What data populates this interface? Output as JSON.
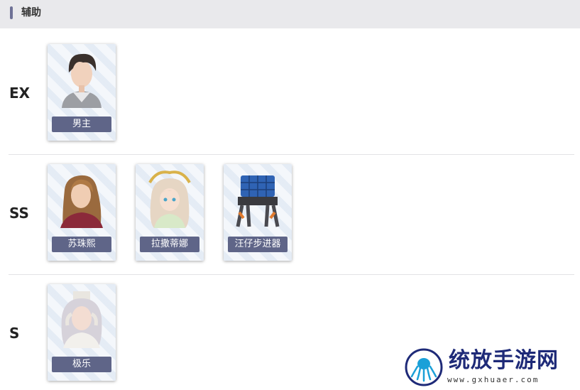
{
  "header": {
    "title": "辅助"
  },
  "tiers": [
    {
      "label": "EX",
      "characters": [
        {
          "name": "男主",
          "icon": "male-lead-portrait"
        }
      ]
    },
    {
      "label": "SS",
      "characters": [
        {
          "name": "苏珠熙",
          "icon": "su-zhuxi-portrait"
        },
        {
          "name": "拉撒蒂娜",
          "icon": "lasatina-portrait"
        },
        {
          "name": "汪仔步进器",
          "icon": "wangzai-walker-portrait"
        }
      ]
    },
    {
      "label": "S",
      "characters": [
        {
          "name": "极乐",
          "icon": "jile-portrait"
        }
      ]
    }
  ],
  "watermark": {
    "text": "统放手游网",
    "url": "www.gxhuaer.com"
  },
  "colors": {
    "accent": "#6e7196",
    "name_tag": "#5f6588",
    "header_bg": "#e9e9ec",
    "watermark": "#1e2a78"
  }
}
